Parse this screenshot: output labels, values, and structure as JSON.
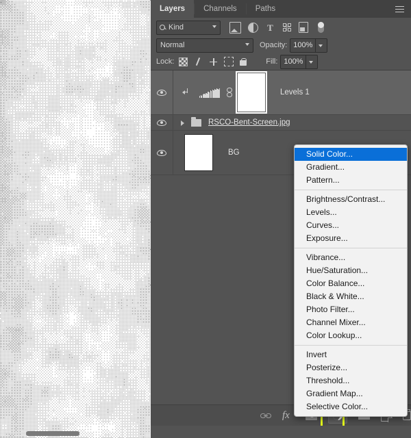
{
  "app": {
    "name": "Adobe Photoshop Layers Panel"
  },
  "canvas": {
    "name": "document-canvas",
    "description": "halftone dithered grayscale texture"
  },
  "panel": {
    "tabs": [
      {
        "label": "Layers",
        "active": true
      },
      {
        "label": "Channels",
        "active": false
      },
      {
        "label": "Paths",
        "active": false
      }
    ],
    "menu_icon": "hamburger-icon",
    "filter": {
      "kind_label": "Kind",
      "search_icon": "search-icon",
      "dropdown_icon": "chevron-down-icon",
      "icons": [
        "image-filter-icon",
        "adjustment-filter-icon",
        "type-filter-icon",
        "shape-filter-icon",
        "smart-object-filter-icon",
        "filter-toggle-switch"
      ]
    },
    "blend": {
      "mode": "Normal",
      "opacity_label": "Opacity:",
      "opacity_value": "100%"
    },
    "lock": {
      "label": "Lock:",
      "icons": [
        "lock-transparent-pixels-icon",
        "lock-image-pixels-icon",
        "lock-position-icon",
        "lock-artboard-icon",
        "lock-all-icon"
      ],
      "fill_label": "Fill:",
      "fill_value": "100%"
    },
    "layers": [
      {
        "name": "Levels 1",
        "type": "adjustment",
        "visible": true,
        "selected": true,
        "clipped": true,
        "linked": true,
        "thumb": "levels-histogram-thumbnail",
        "mask": "white-layer-mask-thumbnail"
      },
      {
        "name": "RSCO-Bent-Screen.jpg",
        "type": "group",
        "visible": true,
        "selected": false,
        "expanded": false
      },
      {
        "name": "BG",
        "type": "pixel",
        "visible": true,
        "selected": false,
        "thumb": "white-layer-thumbnail"
      }
    ],
    "bottom_toolbar": [
      {
        "name": "link-layers-button",
        "icon": "link-icon"
      },
      {
        "name": "layer-style-button",
        "icon": "fx-icon",
        "label": "fx"
      },
      {
        "name": "add-layer-mask-button",
        "icon": "mask-icon"
      },
      {
        "name": "new-adjustment-layer-button",
        "icon": "adjustment-half-circle-icon",
        "highlighted": true
      },
      {
        "name": "new-group-button",
        "icon": "folder-icon"
      },
      {
        "name": "new-layer-button",
        "icon": "new-layer-icon"
      },
      {
        "name": "delete-layer-button",
        "icon": "trash-icon"
      }
    ],
    "highlight_color": "#e8ff1c"
  },
  "context_menu": {
    "name": "new-adjustment-layer-menu",
    "highlight_color": "#0a6fd8",
    "groups": [
      [
        "Solid Color...",
        "Gradient...",
        "Pattern..."
      ],
      [
        "Brightness/Contrast...",
        "Levels...",
        "Curves...",
        "Exposure..."
      ],
      [
        "Vibrance...",
        "Hue/Saturation...",
        "Color Balance...",
        "Black & White...",
        "Photo Filter...",
        "Channel Mixer...",
        "Color Lookup..."
      ],
      [
        "Invert",
        "Posterize...",
        "Threshold...",
        "Gradient Map...",
        "Selective Color..."
      ]
    ],
    "highlighted_item": "Solid Color..."
  }
}
